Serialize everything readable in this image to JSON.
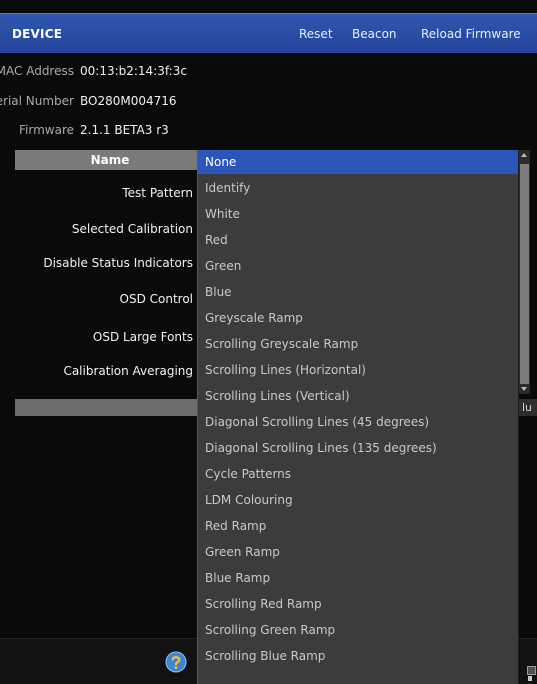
{
  "header": {
    "title": "DEVICE",
    "reset_label": "Reset",
    "beacon_label": "Beacon",
    "reload_label": "Reload Firmware"
  },
  "device_info": {
    "mac_label": "MAC Address",
    "mac_value": "00:13:b2:14:3f:3c",
    "serial_label": "Serial Number",
    "serial_value": "BO280M004716",
    "firmware_label": "Firmware",
    "firmware_value": "2.1.1 BETA3 r3"
  },
  "table": {
    "name_header": "Name",
    "rows": [
      "Test Pattern",
      "Selected Calibration",
      "Disable Status Indicators",
      "OSD Control",
      "OSD Large Fonts",
      "Calibration Averaging"
    ],
    "peek_text": "lu"
  },
  "dropdown": {
    "selected": "None",
    "options": [
      "None",
      "Identify",
      "White",
      "Red",
      "Green",
      "Blue",
      "Greyscale Ramp",
      "Scrolling Greyscale Ramp",
      "Scrolling Lines (Horizontal)",
      "Scrolling Lines (Vertical)",
      "Diagonal Scrolling Lines (45 degrees)",
      "Diagonal Scrolling Lines (135 degrees)",
      "Cycle Patterns",
      "LDM Colouring",
      "Red Ramp",
      "Green Ramp",
      "Blue Ramp",
      "Scrolling Red Ramp",
      "Scrolling Green Ramp",
      "Scrolling Blue Ramp"
    ]
  },
  "colors": {
    "header_blue": "#2b4fa8",
    "selection_blue": "#2b55b8",
    "dropdown_bg": "#3c3c3c",
    "background": "#0a0a0a"
  },
  "icons": {
    "help": "help-icon",
    "corner": "device-icon"
  }
}
